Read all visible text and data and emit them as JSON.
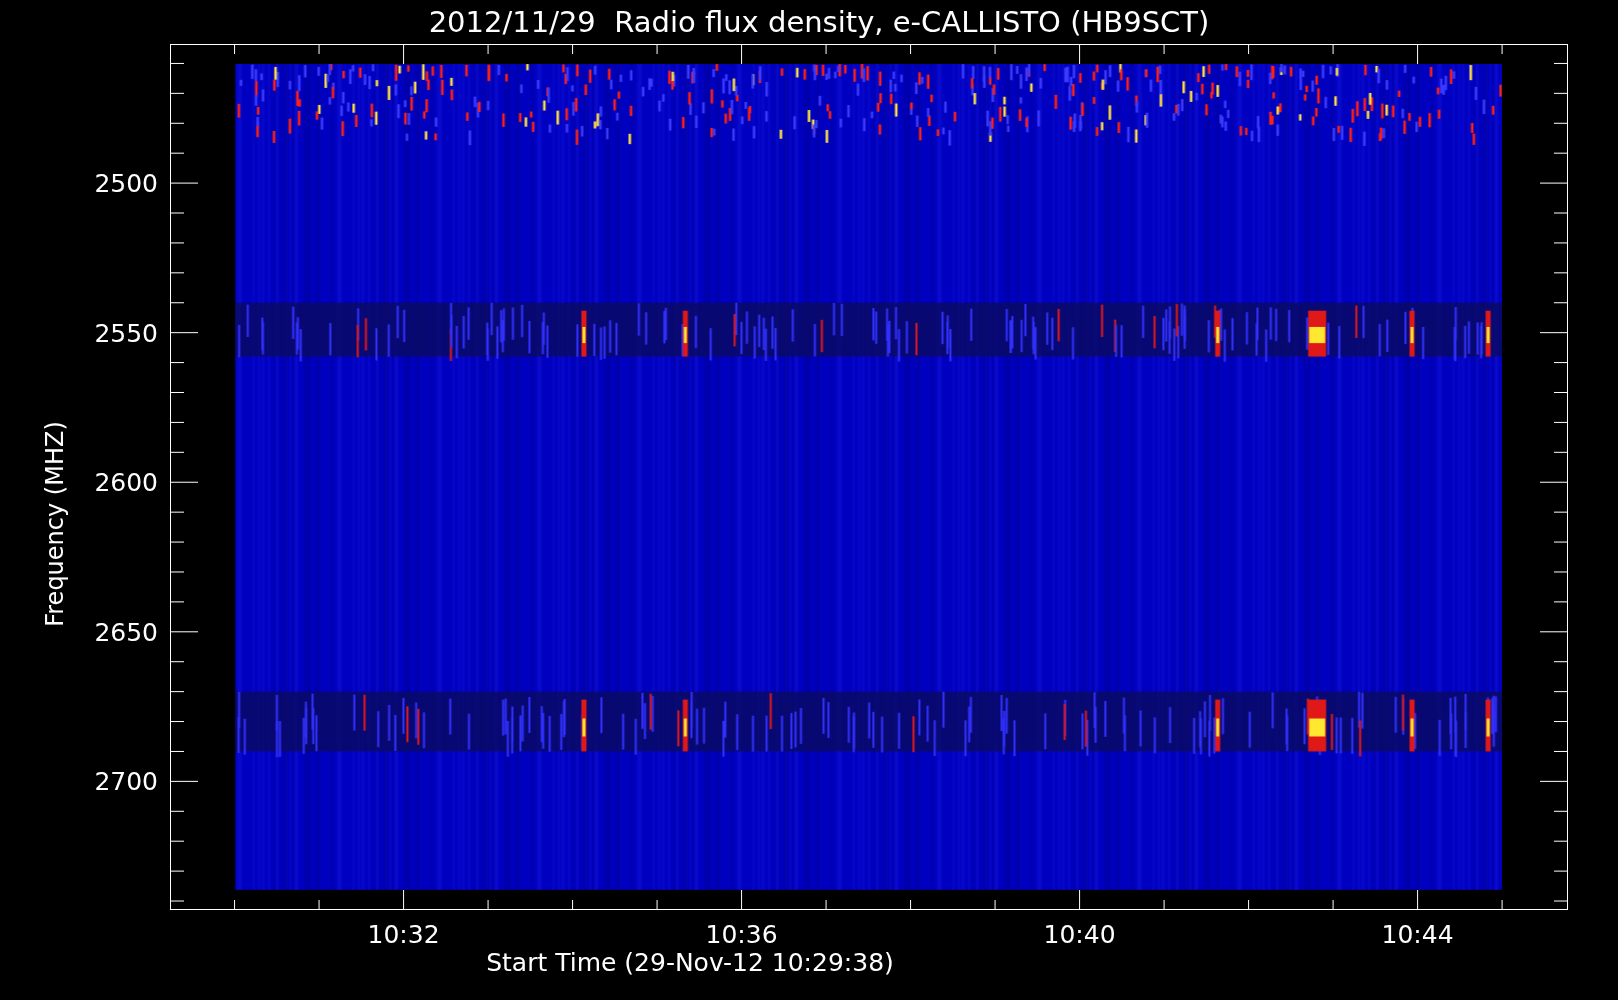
{
  "chart_data": {
    "type": "heatmap",
    "title": "2012/11/29  Radio flux density, e-CALLISTO (HB9SCT)",
    "xlabel": "Start Time (29-Nov-12 10:29:38)",
    "ylabel": "Frequency (MHZ)",
    "categories": [
      "10:32",
      "10:36",
      "10:40",
      "10:44"
    ],
    "ylim": [
      2743,
      2453.5
    ],
    "yticks": [
      {
        "value": 2500,
        "label": "2500"
      },
      {
        "value": 2550,
        "label": "2550"
      },
      {
        "value": 2600,
        "label": "2600"
      },
      {
        "value": 2650,
        "label": "2650"
      },
      {
        "value": 2700,
        "label": "2700"
      }
    ]
  }
}
